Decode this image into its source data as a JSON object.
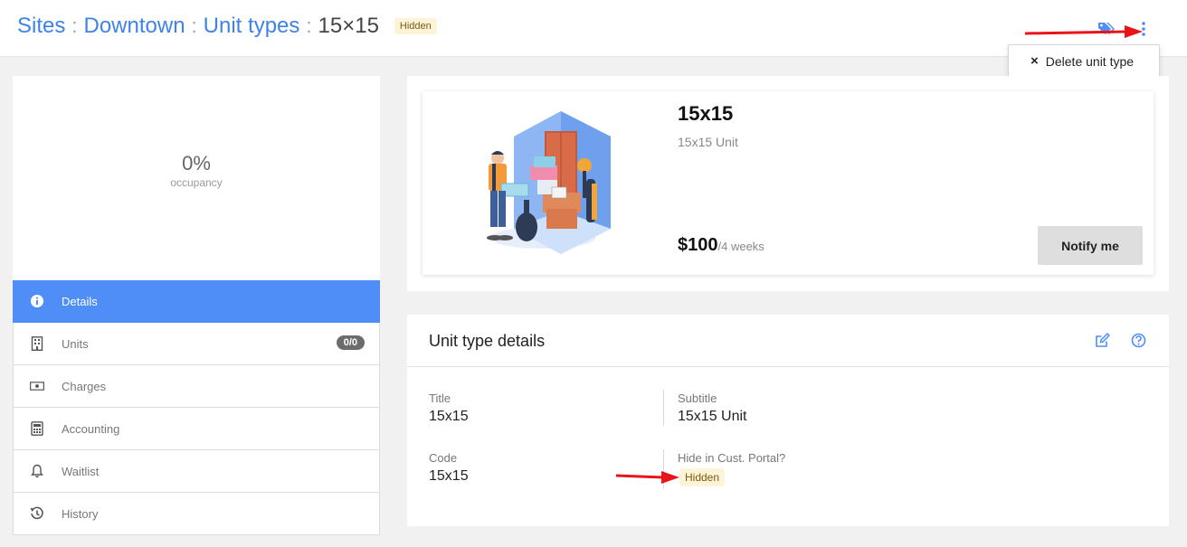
{
  "breadcrumb": {
    "items": [
      "Sites",
      "Downtown",
      "Unit types"
    ],
    "separator": ":",
    "current": "15×15",
    "badge": "Hidden"
  },
  "header_actions": {
    "tags_icon": "tags-icon",
    "more_icon": "vertical-dots-icon"
  },
  "dropdown": {
    "delete_label": "Delete unit type",
    "delete_icon": "×"
  },
  "occupancy": {
    "value": "0%",
    "label": "occupancy"
  },
  "sidebar": {
    "items": [
      {
        "label": "Details",
        "icon": "info-icon",
        "active": true
      },
      {
        "label": "Units",
        "icon": "building-icon",
        "count": "0/0"
      },
      {
        "label": "Charges",
        "icon": "money-icon"
      },
      {
        "label": "Accounting",
        "icon": "calculator-icon"
      },
      {
        "label": "Waitlist",
        "icon": "bell-icon"
      },
      {
        "label": "History",
        "icon": "history-icon"
      }
    ]
  },
  "preview": {
    "title": "15x15",
    "subtitle": "15x15 Unit",
    "price": "$100",
    "period": "/4 weeks",
    "notify_label": "Notify me"
  },
  "details": {
    "title": "Unit type details",
    "fields": {
      "title_label": "Title",
      "title_value": "15x15",
      "subtitle_label": "Subtitle",
      "subtitle_value": "15x15 Unit",
      "code_label": "Code",
      "code_value": "15x15",
      "hide_label": "Hide in Cust. Portal?",
      "hide_value": "Hidden"
    }
  },
  "colors": {
    "accent": "#4f8ef7",
    "link": "#3f82ea",
    "badge_bg": "#fdf3d6",
    "annotation_arrow": "#e8141a"
  }
}
